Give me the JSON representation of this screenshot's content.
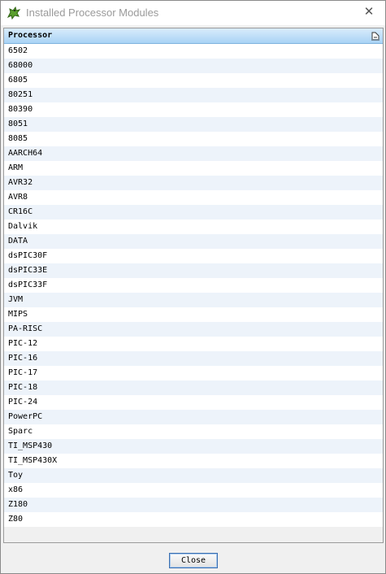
{
  "window": {
    "title": "Installed Processor Modules",
    "title_icon": "dragon-icon",
    "close_glyph": "✕"
  },
  "table": {
    "column_header": "Processor",
    "sort_icon": "sort-column-icon",
    "rows": [
      "6502",
      "68000",
      "6805",
      "80251",
      "80390",
      "8051",
      "8085",
      "AARCH64",
      "ARM",
      "AVR32",
      "AVR8",
      "CR16C",
      "Dalvik",
      "DATA",
      "dsPIC30F",
      "dsPIC33E",
      "dsPIC33F",
      "JVM",
      "MIPS",
      "PA-RISC",
      "PIC-12",
      "PIC-16",
      "PIC-17",
      "PIC-18",
      "PIC-24",
      "PowerPC",
      "Sparc",
      "TI_MSP430",
      "TI_MSP430X",
      "Toy",
      "x86",
      "Z180",
      "Z80"
    ]
  },
  "footer": {
    "close_label": "Close"
  },
  "colors": {
    "header_gradient_top": "#d9ecfb",
    "header_gradient_bottom": "#a9d3f5",
    "row_alt": "#edf3fa",
    "button_focus": "#3a6fb0"
  }
}
